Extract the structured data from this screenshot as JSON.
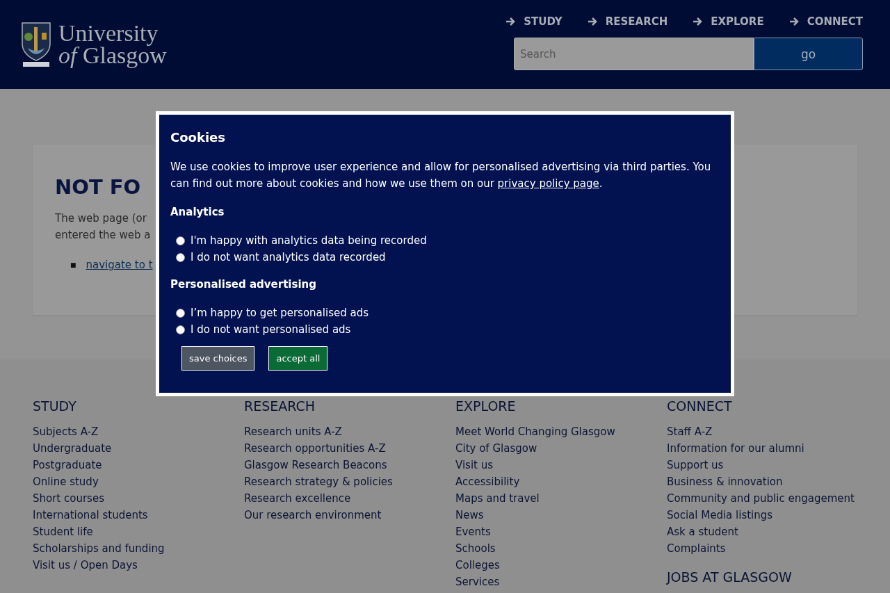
{
  "header": {
    "logo": {
      "line1": "University",
      "line2": "*of* Glasgow"
    },
    "nav": [
      {
        "label": "STUDY"
      },
      {
        "label": "RESEARCH"
      },
      {
        "label": "EXPLORE"
      },
      {
        "label": "CONNECT"
      }
    ],
    "search": {
      "placeholder": "Search",
      "button": "go"
    }
  },
  "content": {
    "heading": "NOT FO",
    "lines": [
      "The web page (or",
      "entered the web a"
    ],
    "bullet": "■",
    "links": [
      "navigate to t"
    ]
  },
  "footer": {
    "columns": [
      {
        "heading": "STUDY",
        "links": [
          "Subjects A-Z",
          "Undergraduate",
          "Postgraduate",
          "Online study",
          "Short courses",
          "International students",
          "Student life",
          "Scholarships and funding",
          "Visit us / Open Days"
        ]
      },
      {
        "heading": "RESEARCH",
        "links": [
          "Research units A-Z",
          "Research opportunities A-Z",
          "Glasgow Research Beacons",
          "Research strategy & policies",
          "Research excellence",
          "Our research environment"
        ]
      },
      {
        "heading": "EXPLORE",
        "links": [
          "Meet World Changing Glasgow",
          "City of Glasgow",
          "Visit us",
          "Accessibility",
          "Maps and travel",
          "News",
          "Events",
          "Schools",
          "Colleges",
          "Services"
        ]
      },
      {
        "heading": "CONNECT",
        "links": [
          "Staff A-Z",
          "Information for our alumni",
          "Support us",
          "Business & innovation",
          "Community and public engagement",
          "Social Media listings",
          "Ask a student",
          "Complaints"
        ],
        "subheading": "JOBS AT GLASGOW"
      }
    ]
  },
  "dialog": {
    "title": "Cookies",
    "text": "We use cookies to improve user experience and allow for personalised advertising via third parties. You can find out more about cookies and how we use them on our ",
    "link": "privacy policy page",
    "text_end": ".",
    "groups": [
      {
        "title": "Analytics",
        "options": [
          {
            "label": "I'm happy with analytics data being recorded",
            "selected": false
          },
          {
            "label": "I do not want analytics data recorded",
            "selected": false
          }
        ]
      },
      {
        "title": "Personalised advertising",
        "options": [
          {
            "label": "I’m happy to get personalised ads",
            "selected": false
          },
          {
            "label": "I do not want personalised ads",
            "selected": false
          }
        ]
      }
    ],
    "buttons": [
      {
        "label": "save choices",
        "kind": "secondary"
      },
      {
        "label": "accept all",
        "kind": "primary"
      }
    ]
  }
}
